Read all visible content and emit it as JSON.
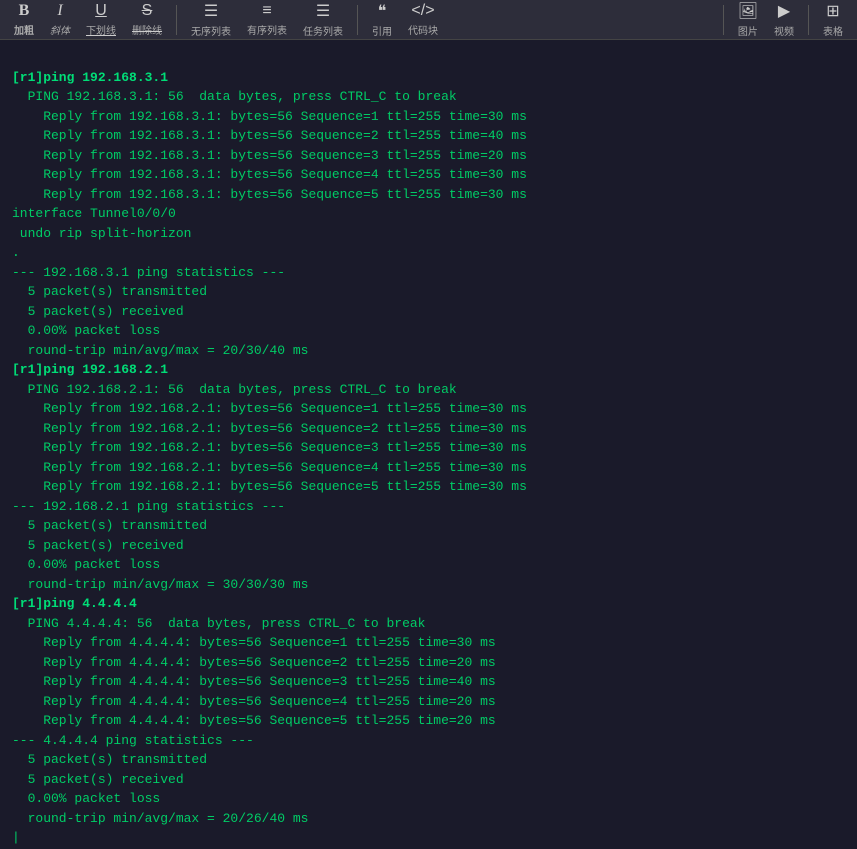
{
  "toolbar": {
    "items": [
      {
        "label": "加粗",
        "icon": "B",
        "style": "bold"
      },
      {
        "label": "斜体",
        "icon": "I",
        "style": "italic"
      },
      {
        "label": "下划线",
        "icon": "U",
        "style": "underline"
      },
      {
        "label": "删除线",
        "icon": "S",
        "style": "strikethrough"
      },
      {
        "label": "无序列表",
        "icon": "≡"
      },
      {
        "label": "有序列表",
        "icon": "≡"
      },
      {
        "label": "任务列表",
        "icon": "≡"
      },
      {
        "label": "引用",
        "icon": "❝"
      },
      {
        "label": "代码块",
        "icon": "</>"
      },
      {
        "label": "图片",
        "icon": "🖼"
      },
      {
        "label": "视频",
        "icon": "▶"
      },
      {
        "label": "表格",
        "icon": "⊞"
      }
    ]
  },
  "terminal": {
    "lines": [
      {
        "type": "cmd",
        "text": "[r1]ping 192.168.3.1"
      },
      {
        "type": "ping-header",
        "text": "  PING 192.168.3.1: 56  data bytes, press CTRL_C to break"
      },
      {
        "type": "reply",
        "text": "    Reply from 192.168.3.1: bytes=56 Sequence=1 ttl=255 time=30 ms"
      },
      {
        "type": "reply",
        "text": "    Reply from 192.168.3.1: bytes=56 Sequence=2 ttl=255 time=40 ms"
      },
      {
        "type": "reply",
        "text": "    Reply from 192.168.3.1: bytes=56 Sequence=3 ttl=255 time=20 ms"
      },
      {
        "type": "reply",
        "text": "    Reply from 192.168.3.1: bytes=56 Sequence=4 ttl=255 time=30 ms"
      },
      {
        "type": "reply",
        "text": "    Reply from 192.168.3.1: bytes=56 Sequence=5 ttl=255 time=30 ms"
      },
      {
        "type": "blank",
        "text": ""
      },
      {
        "type": "interface",
        "text": "interface Tunnel0/0/0"
      },
      {
        "type": "interface",
        "text": " undo rip split-horizon"
      },
      {
        "type": "blank",
        "text": "."
      },
      {
        "type": "stats-header",
        "text": "--- 192.168.3.1 ping statistics ---"
      },
      {
        "type": "stats",
        "text": "  5 packet(s) transmitted"
      },
      {
        "type": "stats",
        "text": "  5 packet(s) received"
      },
      {
        "type": "stats",
        "text": "  0.00% packet loss"
      },
      {
        "type": "stats",
        "text": "  round-trip min/avg/max = 20/30/40 ms"
      },
      {
        "type": "blank",
        "text": ""
      },
      {
        "type": "cmd",
        "text": "[r1]ping 192.168.2.1"
      },
      {
        "type": "ping-header",
        "text": "  PING 192.168.2.1: 56  data bytes, press CTRL_C to break"
      },
      {
        "type": "reply",
        "text": "    Reply from 192.168.2.1: bytes=56 Sequence=1 ttl=255 time=30 ms"
      },
      {
        "type": "reply",
        "text": "    Reply from 192.168.2.1: bytes=56 Sequence=2 ttl=255 time=30 ms"
      },
      {
        "type": "reply",
        "text": "    Reply from 192.168.2.1: bytes=56 Sequence=3 ttl=255 time=30 ms"
      },
      {
        "type": "reply",
        "text": "    Reply from 192.168.2.1: bytes=56 Sequence=4 ttl=255 time=30 ms"
      },
      {
        "type": "reply",
        "text": "    Reply from 192.168.2.1: bytes=56 Sequence=5 ttl=255 time=30 ms"
      },
      {
        "type": "blank",
        "text": ""
      },
      {
        "type": "stats-header",
        "text": "--- 192.168.2.1 ping statistics ---"
      },
      {
        "type": "stats",
        "text": "  5 packet(s) transmitted"
      },
      {
        "type": "stats",
        "text": "  5 packet(s) received"
      },
      {
        "type": "stats",
        "text": "  0.00% packet loss"
      },
      {
        "type": "stats",
        "text": "  round-trip min/avg/max = 30/30/30 ms"
      },
      {
        "type": "blank",
        "text": ""
      },
      {
        "type": "cmd",
        "text": "[r1]ping 4.4.4.4"
      },
      {
        "type": "ping-header",
        "text": "  PING 4.4.4.4: 56  data bytes, press CTRL_C to break"
      },
      {
        "type": "reply",
        "text": "    Reply from 4.4.4.4: bytes=56 Sequence=1 ttl=255 time=30 ms"
      },
      {
        "type": "reply",
        "text": "    Reply from 4.4.4.4: bytes=56 Sequence=2 ttl=255 time=20 ms"
      },
      {
        "type": "reply",
        "text": "    Reply from 4.4.4.4: bytes=56 Sequence=3 ttl=255 time=40 ms"
      },
      {
        "type": "reply",
        "text": "    Reply from 4.4.4.4: bytes=56 Sequence=4 ttl=255 time=20 ms"
      },
      {
        "type": "reply",
        "text": "    Reply from 4.4.4.4: bytes=56 Sequence=5 ttl=255 time=20 ms"
      },
      {
        "type": "blank",
        "text": ""
      },
      {
        "type": "stats-header",
        "text": "--- 4.4.4.4 ping statistics ---"
      },
      {
        "type": "stats",
        "text": "  5 packet(s) transmitted"
      },
      {
        "type": "stats",
        "text": "  5 packet(s) received"
      },
      {
        "type": "stats",
        "text": "  0.00% packet loss"
      },
      {
        "type": "stats",
        "text": "  round-trip min/avg/max = 20/26/40 ms"
      },
      {
        "type": "blank",
        "text": ""
      },
      {
        "type": "cursor",
        "text": "|"
      }
    ]
  }
}
